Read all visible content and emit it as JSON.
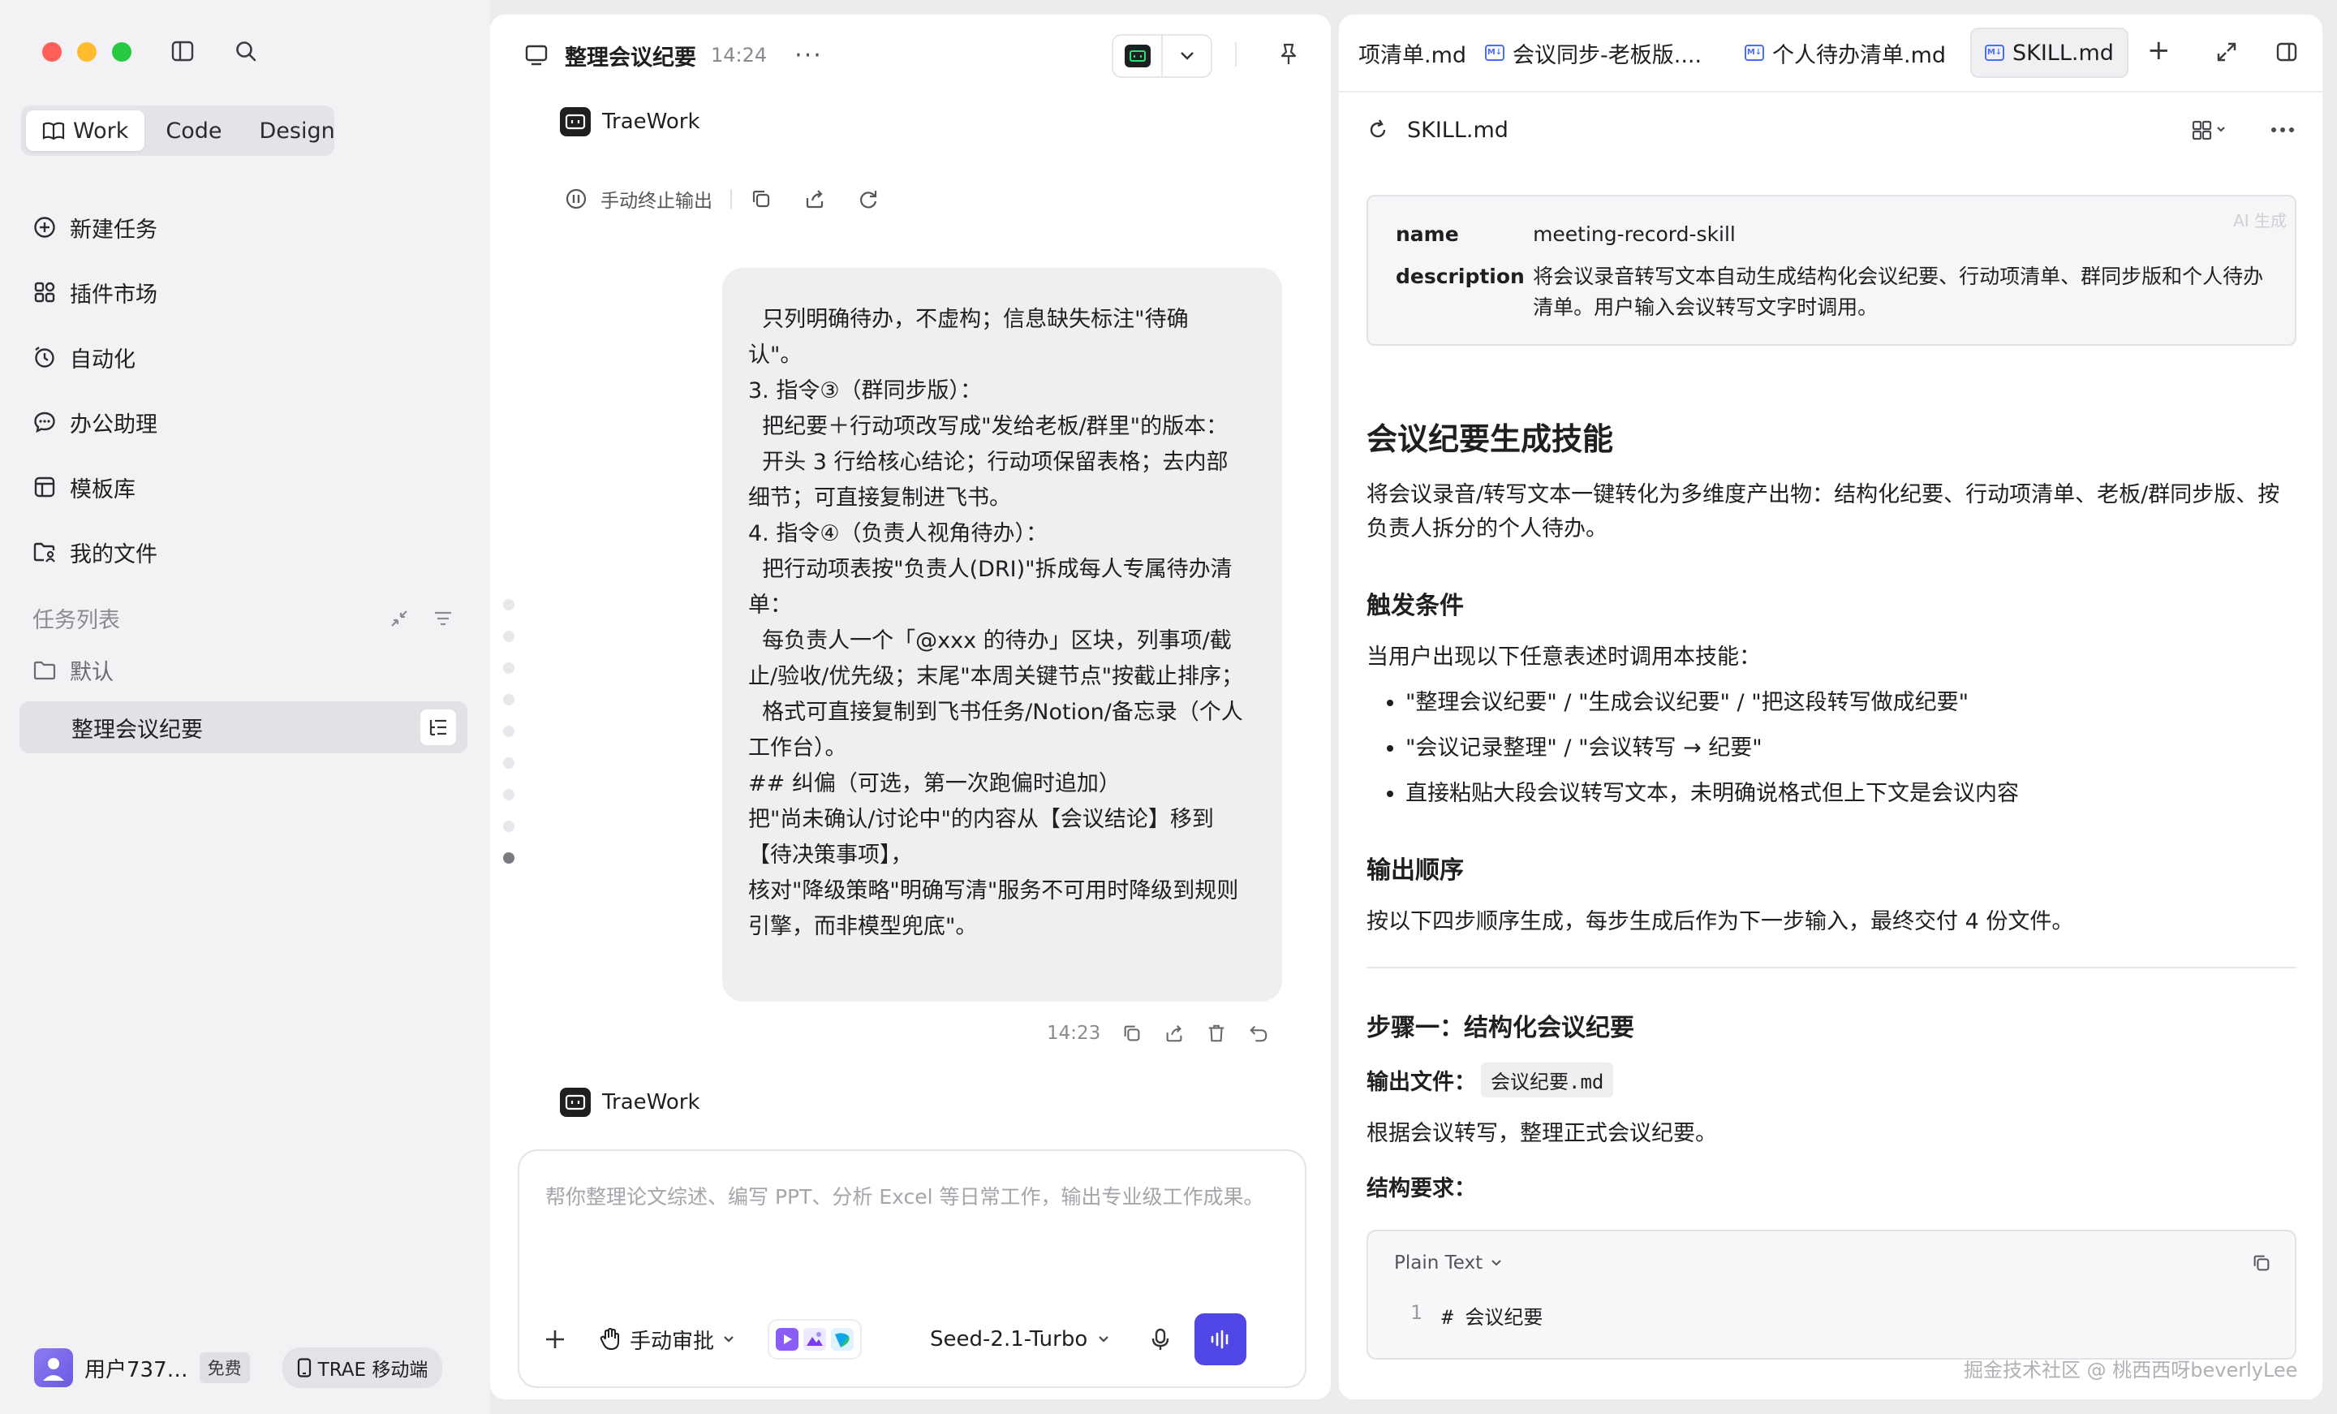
{
  "sidebar": {
    "modes": [
      {
        "label": "Work",
        "active": true
      },
      {
        "label": "Code",
        "active": false
      },
      {
        "label": "Design",
        "active": false
      }
    ],
    "nav": [
      {
        "label": "新建任务",
        "icon": "plus-circle-icon"
      },
      {
        "label": "插件市场",
        "icon": "plugin-grid-icon"
      },
      {
        "label": "自动化",
        "icon": "alarm-clock-icon"
      },
      {
        "label": "办公助理",
        "icon": "chat-bubble-icon"
      },
      {
        "label": "模板库",
        "icon": "template-icon"
      },
      {
        "label": "我的文件",
        "icon": "folder-user-icon"
      }
    ],
    "task_section_label": "任务列表",
    "folder_label": "默认",
    "active_task": "整理会议纪要",
    "user_name": "用户737…",
    "plan_badge": "免费",
    "mobile_button": "TRAE 移动端"
  },
  "chat": {
    "title": "整理会议纪要",
    "time": "14:24",
    "more": "···",
    "bot_name": "TraeWork",
    "stop_label": "手动终止输出",
    "bubble_lines": [
      "  只列明确待办，不虚构；信息缺失标注\"待确",
      "认\"。",
      "3. 指令③（群同步版）：",
      "  把纪要＋行动项改写成\"发给老板/群里\"的版本：",
      "  开头 3 行给核心结论；行动项保留表格；去内部",
      "细节；可直接复制进飞书。",
      "4. 指令④（负责人视角待办）：",
      "  把行动项表按\"负责人(DRI)\"拆成每人专属待办清",
      "单：",
      "  每负责人一个「@xxx 的待办」区块，列事项/截",
      "止/验收/优先级；末尾\"本周关键节点\"按截止排序；",
      "  格式可直接复制到飞书任务/Notion/备忘录（个人",
      "工作台）。",
      "",
      "## 纠偏（可选，第一次跑偏时追加）",
      "把\"尚未确认/讨论中\"的内容从【会议结论】移到",
      "【待决策事项】，",
      "核对\"降级策略\"明确写清\"服务不可用时降级到规则",
      "引擎，而非模型兜底\"。"
    ],
    "msg_time": "14:23",
    "composer_placeholder": "帮你整理论文综述、编写 PPT、分析 Excel 等日常工作，输出专业级工作成果。",
    "approve_label": "手动审批",
    "model_label": "Seed-2.1-Turbo"
  },
  "file_panel": {
    "tabs": [
      {
        "label": "项清单.md",
        "active": false
      },
      {
        "label": "会议同步-老板版....",
        "active": false
      },
      {
        "label": "个人待办清单.md",
        "active": false
      },
      {
        "label": "SKILL.md",
        "active": true
      }
    ],
    "add_tab": "+",
    "path": "SKILL.md",
    "meta": {
      "name_key": "name",
      "name_val": "meeting-record-skill",
      "desc_key": "description",
      "desc_val": "将会议录音转写文本自动生成结构化会议纪要、行动项清单、群同步版和个人待办清单。用户输入会议转写文字时调用。"
    },
    "ai_watermark": "AI 生成",
    "h1": "会议纪要生成技能",
    "intro": "将会议录音/转写文本一键转化为多维度产出物：结构化纪要、行动项清单、老板/群同步版、按负责人拆分的个人待办。",
    "h2_trigger": "触发条件",
    "trigger_intro": "当用户出现以下任意表述时调用本技能：",
    "triggers": [
      "\"整理会议纪要\" / \"生成会议纪要\" / \"把这段转写做成纪要\"",
      "\"会议记录整理\" / \"会议转写 → 纪要\"",
      "直接粘贴大段会议转写文本，未明确说格式但上下文是会议内容"
    ],
    "h2_order": "输出顺序",
    "order_text": "按以下四步顺序生成，每步生成后作为下一步输入，最终交付 4 份文件。",
    "h2_step1": "步骤一：结构化会议纪要",
    "output_file_label": "输出文件：",
    "output_file_name": "会议纪要.md",
    "step1_desc": "根据会议转写，整理正式会议纪要。",
    "structure_label": "结构要求：",
    "code_lang": "Plain Text",
    "code_line_num": "1",
    "code_line_text": "# 会议纪要"
  },
  "watermark": "掘金技术社区 @ 桃西西呀beverlyLee",
  "colors": {
    "accent": "#4f46e5",
    "traffic_red": "#fe5f57",
    "traffic_yellow": "#febc2e",
    "traffic_green": "#28c840"
  }
}
